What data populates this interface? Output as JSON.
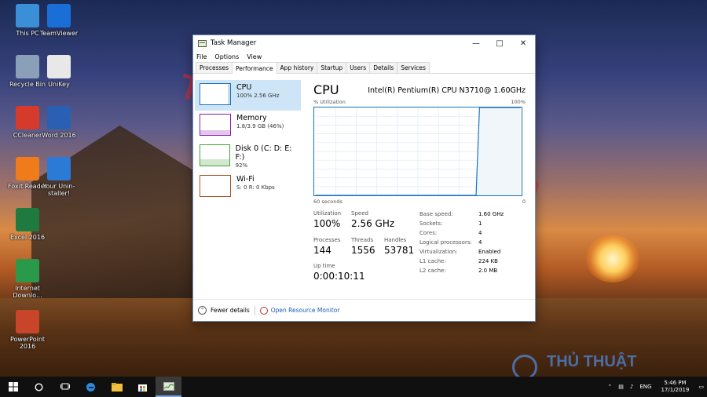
{
  "desktop_icons": [
    {
      "label": "This PC",
      "icon": "computer-icon",
      "color": "#3b8fd6"
    },
    {
      "label": "TeamViewer",
      "icon": "teamviewer-icon",
      "color": "#1a6fd6"
    },
    {
      "label": "Recycle Bin",
      "icon": "recycle-bin-icon",
      "color": "#8aa0b8"
    },
    {
      "label": "UniKey",
      "icon": "unikey-icon",
      "color": "#e8e8e8"
    },
    {
      "label": "CCleaner",
      "icon": "ccleaner-icon",
      "color": "#d63a2a"
    },
    {
      "label": "Word 2016",
      "icon": "word-icon",
      "color": "#2b5fb4"
    },
    {
      "label": "Foxit Reader",
      "icon": "foxit-icon",
      "color": "#f07b1a"
    },
    {
      "label": "Your Unin-staller!",
      "icon": "uninstaller-icon",
      "color": "#2a7ad6"
    },
    {
      "label": "Excel 2016",
      "icon": "excel-icon",
      "color": "#1f7a3f"
    },
    {
      "label": "Internet Downlo...",
      "icon": "idm-icon",
      "color": "#2a9a4a"
    },
    {
      "label": "PowerPoint 2016",
      "icon": "powerpoint-icon",
      "color": "#c8452a"
    }
  ],
  "watermark": "ThuThuatHuuIch.Com",
  "brand_logo": "THỦ THUẬT",
  "window": {
    "title": "Task Manager",
    "menu": [
      "File",
      "Options",
      "View"
    ],
    "tabs": [
      "Processes",
      "Performance",
      "App history",
      "Startup",
      "Users",
      "Details",
      "Services"
    ],
    "active_tab": "Performance",
    "sidebar": [
      {
        "title": "CPU",
        "sub": "100% 2.56 GHz",
        "color": "#1773b8",
        "level": 1.0
      },
      {
        "title": "Memory",
        "sub": "1.8/3.9 GB (46%)",
        "color": "#8b1cb0",
        "level": 0.46
      },
      {
        "title": "Disk 0 (C: D: E: F:)",
        "sub": "92%",
        "color": "#4aa03a",
        "level": 0.92
      },
      {
        "title": "Wi-Fi",
        "sub": "S: 0 R: 0 Kbps",
        "color": "#a7522a",
        "level": 0.0
      }
    ],
    "main": {
      "heading": "CPU",
      "processor": "Intel(R) Pentium(R) CPU N3710@ 1.60GHz",
      "axis_label": "% Utilization",
      "axis_max": "100%",
      "axis_min": "0",
      "time_span": "60 seconds",
      "stats": {
        "utilization_label": "Utilization",
        "utilization": "100%",
        "speed_label": "Speed",
        "speed": "2.56 GHz",
        "processes_label": "Processes",
        "processes": "144",
        "threads_label": "Threads",
        "threads": "1556",
        "handles_label": "Handles",
        "handles": "53781",
        "uptime_label": "Up time",
        "uptime": "0:00:10:11"
      },
      "specs": [
        {
          "k": "Base speed:",
          "v": "1.60 GHz"
        },
        {
          "k": "Sockets:",
          "v": "1"
        },
        {
          "k": "Cores:",
          "v": "4"
        },
        {
          "k": "Logical processors:",
          "v": "4"
        },
        {
          "k": "Virtualization:",
          "v": "Enabled"
        },
        {
          "k": "L1 cache:",
          "v": "224 KB"
        },
        {
          "k": "L2 cache:",
          "v": "2.0 MB"
        }
      ]
    },
    "footer": {
      "fewer_details": "Fewer details",
      "resource_monitor": "Open Resource Monitor"
    }
  },
  "chart_data": {
    "type": "line",
    "title": "",
    "xlabel": "60 seconds",
    "ylabel": "% Utilization",
    "ylim": [
      0,
      100
    ],
    "x": [
      0,
      10,
      20,
      30,
      40,
      47,
      48,
      50,
      55,
      60
    ],
    "series": [
      {
        "values": [
          0,
          0,
          0,
          0,
          0,
          0,
          100,
          100,
          100,
          100
        ]
      }
    ],
    "grid": true
  },
  "taskbar": {
    "items": [
      "start-icon",
      "cortana-icon",
      "task-view-icon",
      "edge-icon",
      "file-explorer-icon",
      "store-icon",
      "task-manager-icon"
    ],
    "lang": "ENG",
    "time": "5:46 PM",
    "date": "17/1/2019"
  }
}
